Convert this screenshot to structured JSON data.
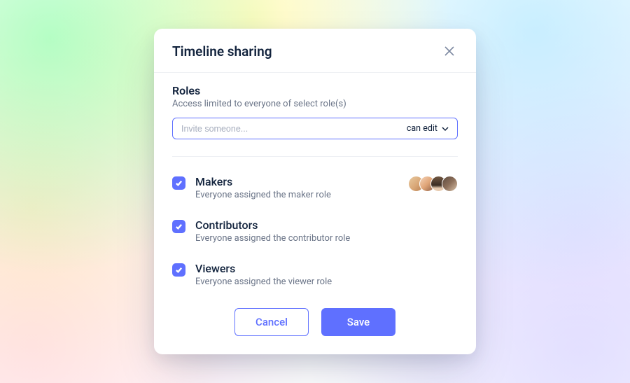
{
  "modal": {
    "title": "Timeline sharing"
  },
  "roles_section": {
    "title": "Roles",
    "subtitle": "Access limited to everyone of select role(s)"
  },
  "invite": {
    "placeholder": "Invite someone...",
    "permission_label": "can edit"
  },
  "roles": [
    {
      "name": "Makers",
      "desc": "Everyone assigned the maker role",
      "checked": true,
      "avatar_count": 4
    },
    {
      "name": "Contributors",
      "desc": "Everyone assigned the contributor role",
      "checked": true,
      "avatar_count": 0
    },
    {
      "name": "Viewers",
      "desc": "Everyone assigned the viewer role",
      "checked": true,
      "avatar_count": 0
    }
  ],
  "footer": {
    "cancel": "Cancel",
    "save": "Save"
  },
  "colors": {
    "accent": "#5f70ff",
    "text_primary": "#12233d",
    "text_muted": "#6b7588"
  }
}
